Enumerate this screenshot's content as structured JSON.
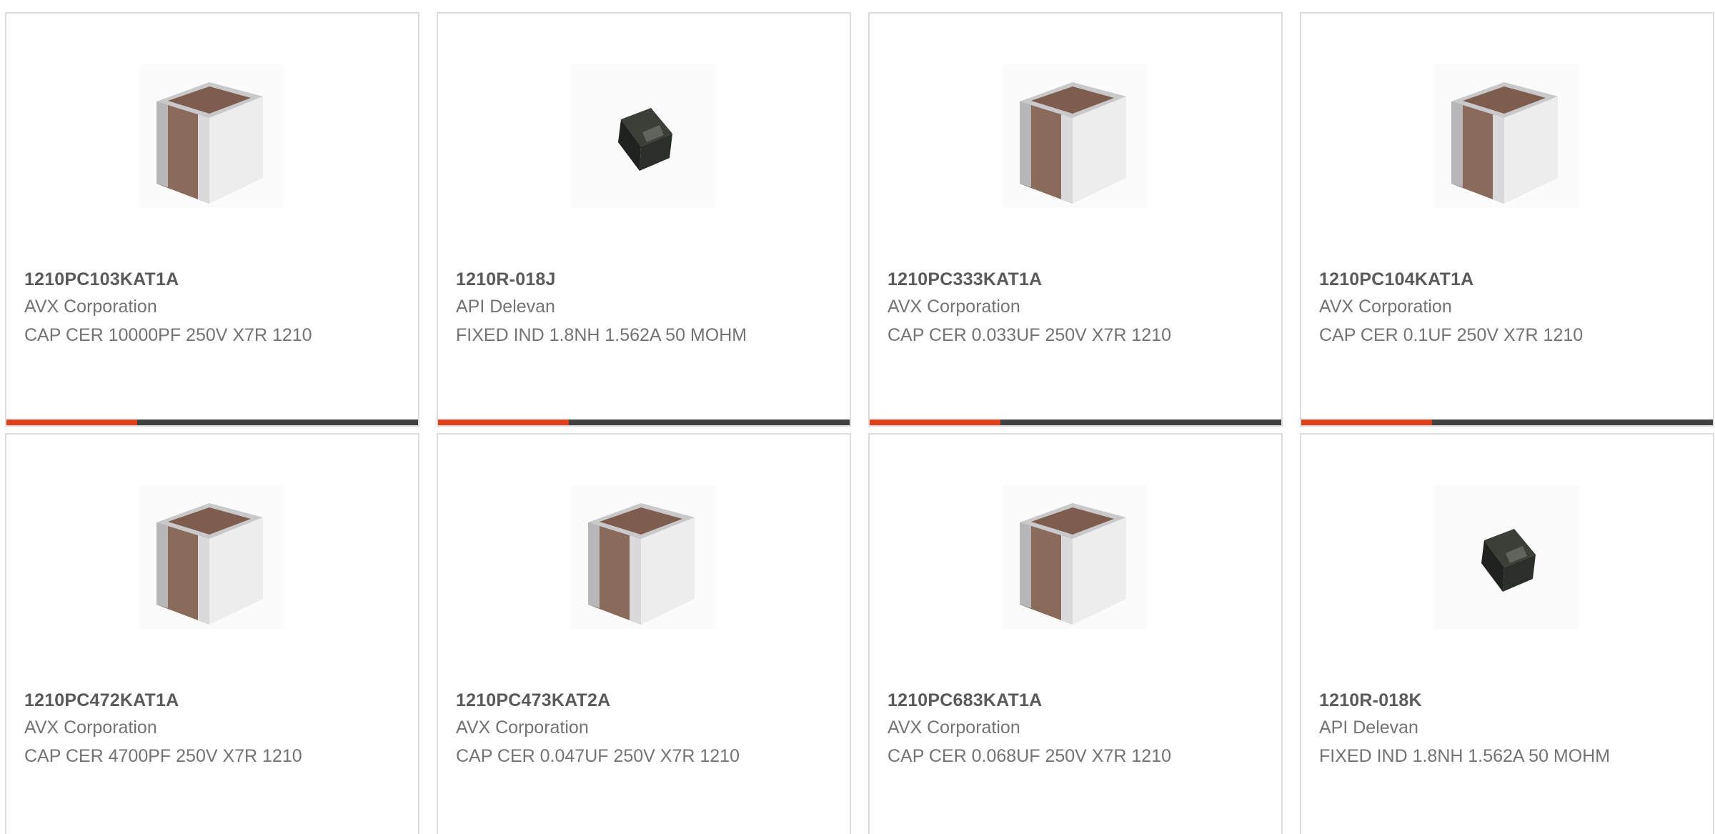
{
  "products": [
    {
      "part": "1210PC103KAT1A",
      "manufacturer": "AVX Corporation",
      "description": "CAP CER 10000PF 250V X7R 1210",
      "image_icon": "capacitor-icon"
    },
    {
      "part": "1210R-018J",
      "manufacturer": "API Delevan",
      "description": "FIXED IND 1.8NH 1.562A 50 MOHM",
      "image_icon": "inductor-icon"
    },
    {
      "part": "1210PC333KAT1A",
      "manufacturer": "AVX Corporation",
      "description": "CAP CER 0.033UF 250V X7R 1210",
      "image_icon": "capacitor-icon"
    },
    {
      "part": "1210PC104KAT1A",
      "manufacturer": "AVX Corporation",
      "description": "CAP CER 0.1UF 250V X7R 1210",
      "image_icon": "capacitor-icon"
    },
    {
      "part": "1210PC472KAT1A",
      "manufacturer": "AVX Corporation",
      "description": "CAP CER 4700PF 250V X7R 1210",
      "image_icon": "capacitor-icon"
    },
    {
      "part": "1210PC473KAT2A",
      "manufacturer": "AVX Corporation",
      "description": "CAP CER 0.047UF 250V X7R 1210",
      "image_icon": "capacitor-icon"
    },
    {
      "part": "1210PC683KAT1A",
      "manufacturer": "AVX Corporation",
      "description": "CAP CER 0.068UF 250V X7R 1210",
      "image_icon": "capacitor-icon"
    },
    {
      "part": "1210R-018K",
      "manufacturer": "API Delevan",
      "description": "FIXED IND 1.8NH 1.562A 50 MOHM",
      "image_icon": "inductor-icon"
    }
  ],
  "colors": {
    "accent": "#e0401c",
    "bar": "#414141",
    "border": "#dcdcdc",
    "title_text": "#5a5a5a",
    "body_text": "#737373"
  }
}
